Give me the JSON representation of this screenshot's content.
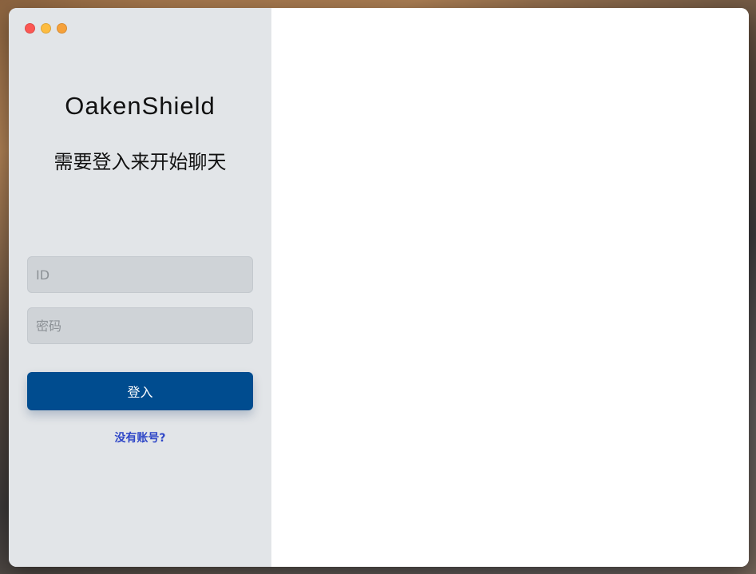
{
  "window": {
    "traffic_lights": [
      "close",
      "minimize",
      "zoom"
    ]
  },
  "login": {
    "app_title": "OakenShield",
    "subtitle": "需要登入来开始聊天",
    "id_field": {
      "value": "",
      "placeholder": "ID"
    },
    "password_field": {
      "value": "",
      "placeholder": "密码"
    },
    "login_button_label": "登入",
    "signup_link_label": "没有账号?"
  },
  "colors": {
    "sidebar_bg": "#e2e5e8",
    "field_bg": "#cfd3d7",
    "primary_button": "#004c8f",
    "link": "#2f47c7",
    "close_light": "#fc5753",
    "minimize_light": "#fdbc40",
    "zoom_light": "#f6a13a"
  }
}
